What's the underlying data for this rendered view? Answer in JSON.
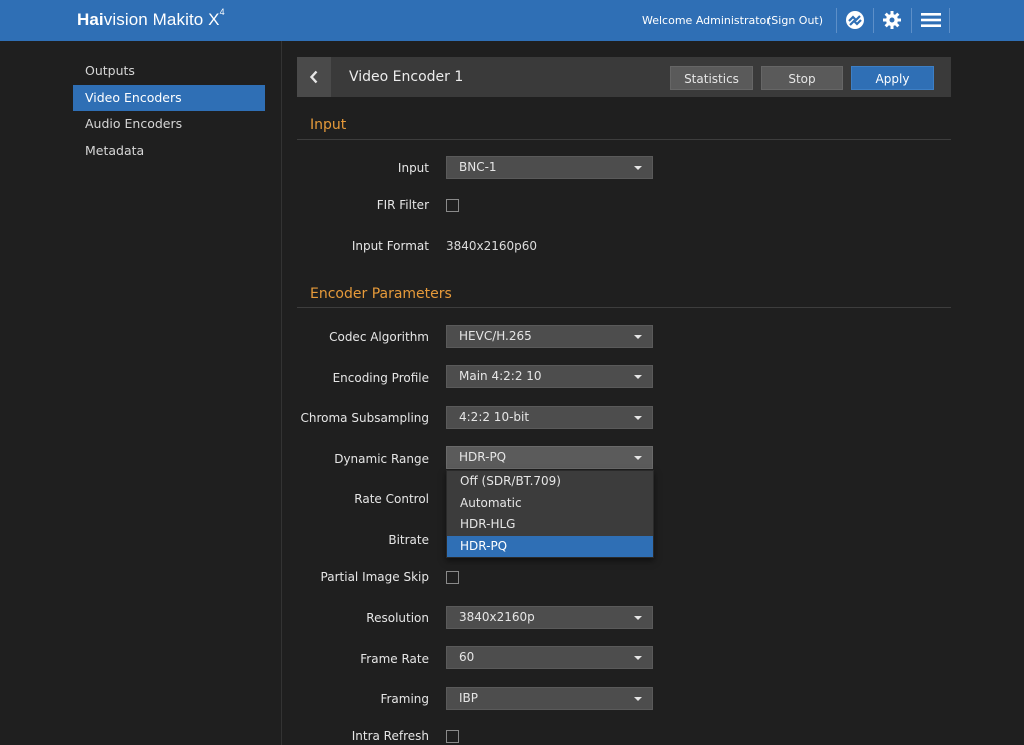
{
  "topbar": {
    "brand_prefix": "Hai",
    "brand_rest": "vision Makito X",
    "brand_sup": "4",
    "welcome": "Welcome Administrator",
    "signout": "(Sign Out)",
    "accent": "#2f6fb5"
  },
  "sidebar": {
    "items": [
      {
        "label": "Outputs"
      },
      {
        "label": "Video Encoders"
      },
      {
        "label": "Audio Encoders"
      },
      {
        "label": "Metadata"
      }
    ],
    "active_index": 1
  },
  "header": {
    "title": "Video Encoder 1",
    "statistics_label": "Statistics",
    "stop_label": "Stop",
    "apply_label": "Apply"
  },
  "input_section": {
    "title": "Input",
    "input_label": "Input",
    "input_value": "BNC-1",
    "fir_label": "FIR Filter",
    "fir_checked": false,
    "format_label": "Input Format",
    "format_value": "3840x2160p60"
  },
  "encoder_section": {
    "title": "Encoder Parameters",
    "codec_label": "Codec Algorithm",
    "codec_value": "HEVC/H.265",
    "profile_label": "Encoding Profile",
    "profile_value": "Main 4:2:2 10",
    "chroma_label": "Chroma Subsampling",
    "chroma_value": "4:2:2 10-bit",
    "dynamic_label": "Dynamic Range",
    "dynamic_value": "HDR-PQ",
    "dynamic_options": [
      "Off (SDR/BT.709)",
      "Automatic",
      "HDR-HLG",
      "HDR-PQ"
    ],
    "dynamic_selected_index": 3,
    "rate_label": "Rate Control",
    "bitrate_label": "Bitrate",
    "skip_label": "Partial Image Skip",
    "skip_checked": false,
    "resolution_label": "Resolution",
    "resolution_value": "3840x2160p",
    "framerate_label": "Frame Rate",
    "framerate_value": "60",
    "framing_label": "Framing",
    "framing_value": "IBP",
    "intra_label": "Intra Refresh",
    "intra_checked": false
  }
}
